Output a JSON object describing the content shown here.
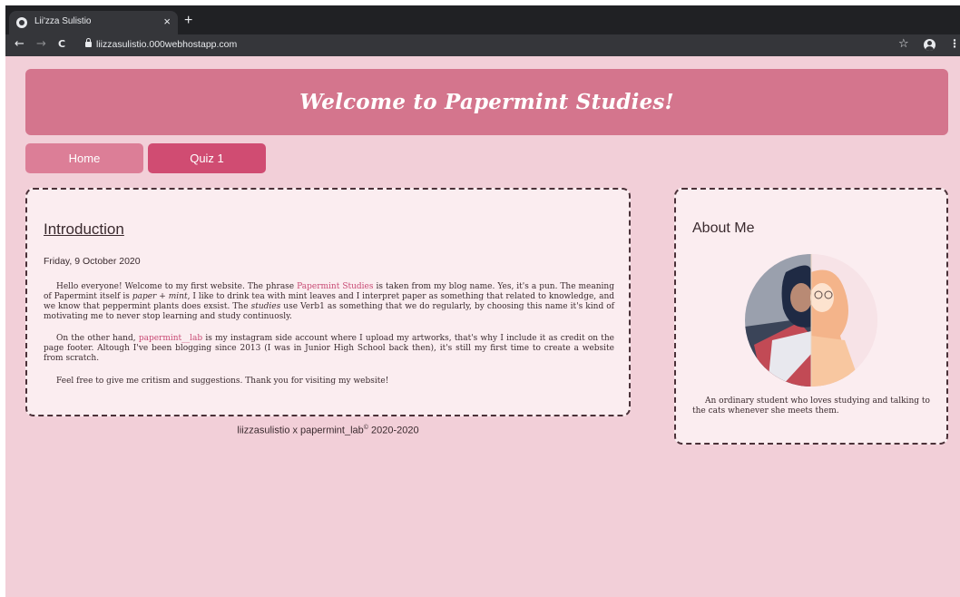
{
  "browser": {
    "tab_title": "Lii'zza Sulistio",
    "tab_close": "×",
    "new_tab": "+",
    "back": "←",
    "forward": "→",
    "reload": "C",
    "url": "liizzasulistio.000webhostapp.com",
    "star": "☆",
    "menu": "⋮"
  },
  "banner": {
    "title": "Welcome to Papermint Studies!"
  },
  "nav": {
    "home": "Home",
    "quiz": "Quiz 1"
  },
  "intro": {
    "heading": "Introduction",
    "date": "Friday, 9 October 2020",
    "p1": {
      "a": "Hello everyone! Welcome to my first website. The phrase ",
      "link": "Papermint Studies",
      "b": " is taken from my blog name. Yes, it's a pun. The meaning of Papermint itself is ",
      "em1": "paper + mint",
      "c": ", I like to drink tea with mint leaves and I interpret paper as something that related to knowledge, and we know that peppermint plants does exsist. The ",
      "em2": "studies",
      "d": " use Verb1 as something that we do regularly, by choosing this name it's kind of motivating me to never stop learning and study continuosly."
    },
    "p2": {
      "a": "On the other hand, ",
      "link": "papermint__lab",
      "b": " is my instagram side account where I upload my artworks, that's why I include it as credit on the page footer. Altough I've been blogging since 2013 (I was in Junior High School back then), it's still my first time to create a website from scratch."
    },
    "p3": "Feel free to give me critism and suggestions. Thank you for visiting my website!"
  },
  "footer": {
    "text": "liizzasulistio x papermint_lab",
    "sup": "©",
    "years": " 2020-2020"
  },
  "about": {
    "heading": "About Me",
    "text": "An ordinary student who loves studying and talking to the cats whenever she meets them."
  },
  "colors": {
    "page_bg": "#f2cfd8",
    "banner": "#d4758d",
    "nav_home": "#dc7e97",
    "nav_quiz": "#d04c72",
    "card_bg": "#fbedf0",
    "link": "#c84a74"
  }
}
